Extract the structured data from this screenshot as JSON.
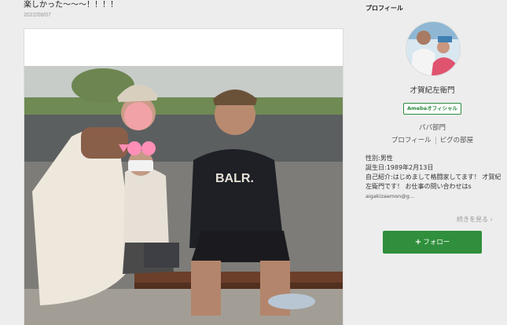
{
  "post": {
    "title": "楽しかった〜〜〜！！！！",
    "date": "2022/08/07"
  },
  "sidebar": {
    "heading": "プロフィール",
    "name": "才賀紀左衛門",
    "badge": "Amebaオフィシャル",
    "group": "パパ部門",
    "links": [
      "プロフィール",
      "ピグの部屋"
    ],
    "gender": "性別:男性",
    "birthday": "誕生日:1989年2月13日",
    "bio": "自己紹介:はじめまして格闘家してます！ 才賀紀左衛門です！ お仕事の問い合わせはs",
    "bio_email": "aigakizaemon@g...",
    "read_more": "続きを見る",
    "follow_label": "フォロー"
  },
  "photo": {
    "shirt_text": "BALR."
  },
  "colors": {
    "accent_green": "#2f8f3c",
    "page_bg": "#ededed"
  }
}
